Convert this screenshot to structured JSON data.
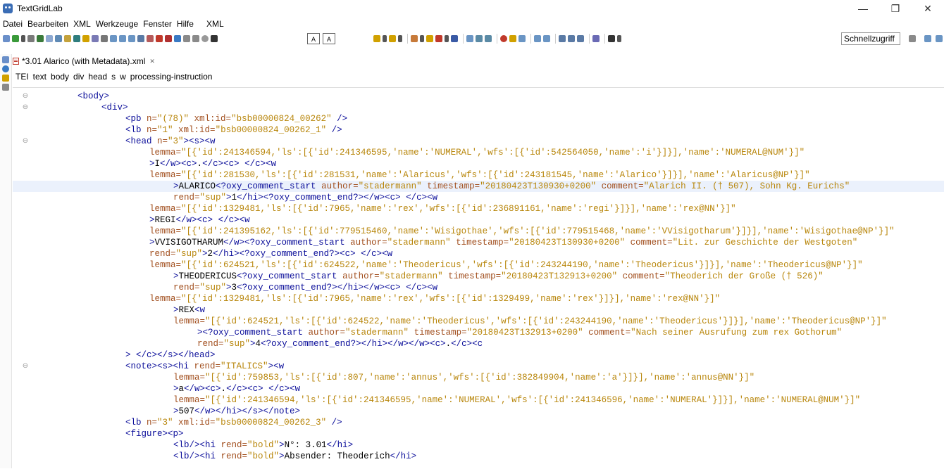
{
  "window": {
    "title": "TextGridLab",
    "minimize": "—",
    "maximize": "❐",
    "close": "✕"
  },
  "menu": [
    "Datei",
    "Bearbeiten",
    "XML",
    "Werkzeuge",
    "Fenster",
    "Hilfe",
    "XML"
  ],
  "toolbar": {
    "quick_access": "Schnellzugriff",
    "text_btn_1": "A",
    "text_btn_2": "A"
  },
  "editor": {
    "tab_title": "*3.01 Alarico (with Metadata).xml",
    "tab_close": "✕",
    "current_line_index": 8
  },
  "breadcrumbs": [
    "TEI",
    "text",
    "body",
    "div",
    "head",
    "s",
    "w",
    "processing-instruction"
  ],
  "colors": {
    "tag": "#0b0e9a",
    "attr_name": "#a14e1d",
    "attr_value": "#b8860b",
    "current_line": "#ebf1fc"
  },
  "code_lines": [
    {
      "indent": 0,
      "fold": true,
      "segs": [
        [
          "t",
          "<body>"
        ]
      ]
    },
    {
      "indent": 1,
      "fold": true,
      "segs": [
        [
          "t",
          "<div>"
        ]
      ]
    },
    {
      "indent": 2,
      "fold": false,
      "segs": [
        [
          "t",
          "<pb "
        ],
        [
          "a",
          "n="
        ],
        [
          "v",
          "\"(78)\""
        ],
        [
          "a",
          " xml:id="
        ],
        [
          "v",
          "\"bsb00000824_00262\""
        ],
        [
          "t",
          " />"
        ]
      ]
    },
    {
      "indent": 2,
      "fold": false,
      "segs": [
        [
          "t",
          "<lb "
        ],
        [
          "a",
          "n="
        ],
        [
          "v",
          "\"1\""
        ],
        [
          "a",
          " xml:id="
        ],
        [
          "v",
          "\"bsb00000824_00262_1\""
        ],
        [
          "t",
          " />"
        ]
      ]
    },
    {
      "indent": 2,
      "fold": true,
      "segs": [
        [
          "t",
          "<head "
        ],
        [
          "a",
          "n="
        ],
        [
          "v",
          "\"3\""
        ],
        [
          "t",
          "><s><w"
        ]
      ]
    },
    {
      "indent": 3,
      "fold": false,
      "segs": [
        [
          "a",
          "lemma="
        ],
        [
          "v",
          "\"[{'id':241346594,'ls':[{'id':241346595,'name':'NUMERAL','wfs':[{'id':542564050,'name':'i'}]}],'name':'NUMERAL@NUM'}]\""
        ]
      ]
    },
    {
      "indent": 3,
      "fold": false,
      "segs": [
        [
          "t",
          ">"
        ],
        [
          "x",
          "I"
        ],
        [
          "t",
          "</w><c>"
        ],
        [
          "x",
          "."
        ],
        [
          "t",
          "</c><c>"
        ],
        [
          "x",
          " "
        ],
        [
          "t",
          "</c><w"
        ]
      ]
    },
    {
      "indent": 3,
      "fold": false,
      "segs": [
        [
          "a",
          "lemma="
        ],
        [
          "v",
          "\"[{'id':281530,'ls':[{'id':281531,'name':'Alaricus','wfs':[{'id':243181545,'name':'Alarico'}]}],'name':'Alaricus@NP'}]\""
        ]
      ]
    },
    {
      "indent": 4,
      "fold": false,
      "segs": [
        [
          "t",
          ">"
        ],
        [
          "x",
          "ALARICO"
        ],
        [
          "t",
          "<?oxy_comment_start "
        ],
        [
          "a",
          "author="
        ],
        [
          "v",
          "\"stadermann\""
        ],
        [
          "a",
          " timestamp="
        ],
        [
          "v",
          "\"20180423T130930+0200\""
        ],
        [
          "a",
          " comment="
        ],
        [
          "v",
          "\"Alarich II. († 507), Sohn Kg. Eurichs\""
        ]
      ]
    },
    {
      "indent": 4,
      "fold": false,
      "segs": [
        [
          "a",
          "rend="
        ],
        [
          "v",
          "\"sup\""
        ],
        [
          "t",
          ">"
        ],
        [
          "x",
          "1"
        ],
        [
          "t",
          "</hi><?oxy_comment_end?></w><c>"
        ],
        [
          "x",
          " "
        ],
        [
          "t",
          "</c><w"
        ]
      ]
    },
    {
      "indent": 3,
      "fold": false,
      "segs": [
        [
          "a",
          "lemma="
        ],
        [
          "v",
          "\"[{'id':1329481,'ls':[{'id':7965,'name':'rex','wfs':[{'id':236891161,'name':'regi'}]}],'name':'rex@NN'}]\""
        ]
      ]
    },
    {
      "indent": 3,
      "fold": false,
      "segs": [
        [
          "t",
          ">"
        ],
        [
          "x",
          "REGI"
        ],
        [
          "t",
          "</w><c>"
        ],
        [
          "x",
          " "
        ],
        [
          "t",
          "</c><w"
        ]
      ]
    },
    {
      "indent": 3,
      "fold": false,
      "segs": [
        [
          "a",
          "lemma="
        ],
        [
          "v",
          "\"[{'id':241395162,'ls':[{'id':779515460,'name':'Wisigothae','wfs':[{'id':779515468,'name':'VVisigotharum'}]}],'name':'Wisigothae@NP'}]\""
        ]
      ]
    },
    {
      "indent": 3,
      "fold": false,
      "segs": [
        [
          "t",
          ">"
        ],
        [
          "x",
          "VVISIGOTHARUM"
        ],
        [
          "t",
          "</w><?oxy_comment_start "
        ],
        [
          "a",
          "author="
        ],
        [
          "v",
          "\"stadermann\""
        ],
        [
          "a",
          " timestamp="
        ],
        [
          "v",
          "\"20180423T130930+0200\""
        ],
        [
          "a",
          " comment="
        ],
        [
          "v",
          "\"Lit. zur Geschichte der Westgoten\""
        ]
      ]
    },
    {
      "indent": 3,
      "fold": false,
      "segs": [
        [
          "a",
          "rend="
        ],
        [
          "v",
          "\"sup\""
        ],
        [
          "t",
          ">"
        ],
        [
          "x",
          "2"
        ],
        [
          "t",
          "</hi><?oxy_comment_end?><c>"
        ],
        [
          "x",
          " "
        ],
        [
          "t",
          "</c><w"
        ]
      ]
    },
    {
      "indent": 3,
      "fold": false,
      "segs": [
        [
          "a",
          "lemma="
        ],
        [
          "v",
          "\"[{'id':624521,'ls':[{'id':624522,'name':'Theodericus','wfs':[{'id':243244190,'name':'Theodericus'}]}],'name':'Theodericus@NP'}]\""
        ]
      ]
    },
    {
      "indent": 4,
      "fold": false,
      "segs": [
        [
          "t",
          ">"
        ],
        [
          "x",
          "THEODERICUS"
        ],
        [
          "t",
          "<?oxy_comment_start "
        ],
        [
          "a",
          "author="
        ],
        [
          "v",
          "\"stadermann\""
        ],
        [
          "a",
          " timestamp="
        ],
        [
          "v",
          "\"20180423T132913+0200\""
        ],
        [
          "a",
          " comment="
        ],
        [
          "v",
          "\"Theoderich der Große († 526)\""
        ]
      ]
    },
    {
      "indent": 4,
      "fold": false,
      "segs": [
        [
          "a",
          "rend="
        ],
        [
          "v",
          "\"sup\""
        ],
        [
          "t",
          ">"
        ],
        [
          "x",
          "3"
        ],
        [
          "t",
          "<?oxy_comment_end?></hi></w><c>"
        ],
        [
          "x",
          " "
        ],
        [
          "t",
          "</c><w"
        ]
      ]
    },
    {
      "indent": 3,
      "fold": false,
      "segs": [
        [
          "a",
          "lemma="
        ],
        [
          "v",
          "\"[{'id':1329481,'ls':[{'id':7965,'name':'rex','wfs':[{'id':1329499,'name':'rex'}]}],'name':'rex@NN'}]\""
        ]
      ]
    },
    {
      "indent": 4,
      "fold": false,
      "segs": [
        [
          "t",
          ">"
        ],
        [
          "x",
          "REX"
        ],
        [
          "t",
          "<w"
        ]
      ]
    },
    {
      "indent": 4,
      "fold": false,
      "segs": [
        [
          "a",
          "lemma="
        ],
        [
          "v",
          "\"[{'id':624521,'ls':[{'id':624522,'name':'Theodericus','wfs':[{'id':243244190,'name':'Theodericus'}]}],'name':'Theodericus@NP'}]\""
        ]
      ]
    },
    {
      "indent": 5,
      "fold": false,
      "segs": [
        [
          "t",
          "><?oxy_comment_start "
        ],
        [
          "a",
          "author="
        ],
        [
          "v",
          "\"stadermann\""
        ],
        [
          "a",
          " timestamp="
        ],
        [
          "v",
          "\"20180423T132913+0200\""
        ],
        [
          "a",
          " comment="
        ],
        [
          "v",
          "\"Nach seiner Ausrufung zum rex Gothorum\""
        ]
      ]
    },
    {
      "indent": 5,
      "fold": false,
      "segs": [
        [
          "a",
          "rend="
        ],
        [
          "v",
          "\"sup\""
        ],
        [
          "t",
          ">"
        ],
        [
          "x",
          "4"
        ],
        [
          "t",
          "<?oxy_comment_end?></hi></w></w><c>"
        ],
        [
          "x",
          "."
        ],
        [
          "t",
          "</c><c"
        ]
      ]
    },
    {
      "indent": 2,
      "fold": false,
      "segs": [
        [
          "t",
          "> </c></s></head>"
        ]
      ]
    },
    {
      "indent": 2,
      "fold": true,
      "segs": [
        [
          "t",
          "<note><s><hi "
        ],
        [
          "a",
          "rend="
        ],
        [
          "v",
          "\"ITALICS\""
        ],
        [
          "t",
          "><w"
        ]
      ]
    },
    {
      "indent": 4,
      "fold": false,
      "segs": [
        [
          "a",
          "lemma="
        ],
        [
          "v",
          "\"[{'id':759853,'ls':[{'id':807,'name':'annus','wfs':[{'id':382849904,'name':'a'}]}],'name':'annus@NN'}]\""
        ]
      ]
    },
    {
      "indent": 4,
      "fold": false,
      "segs": [
        [
          "t",
          ">"
        ],
        [
          "x",
          "a"
        ],
        [
          "t",
          "</w><c>"
        ],
        [
          "x",
          "."
        ],
        [
          "t",
          "</c><c>"
        ],
        [
          "x",
          " "
        ],
        [
          "t",
          "</c><w"
        ]
      ]
    },
    {
      "indent": 4,
      "fold": false,
      "segs": [
        [
          "a",
          "lemma="
        ],
        [
          "v",
          "\"[{'id':241346594,'ls':[{'id':241346595,'name':'NUMERAL','wfs':[{'id':241346596,'name':'NUMERAL'}]}],'name':'NUMERAL@NUM'}]\""
        ]
      ]
    },
    {
      "indent": 4,
      "fold": false,
      "segs": [
        [
          "t",
          ">"
        ],
        [
          "x",
          "507"
        ],
        [
          "t",
          "</w></hi></s></note>"
        ]
      ]
    },
    {
      "indent": 2,
      "fold": false,
      "segs": [
        [
          "t",
          "<lb "
        ],
        [
          "a",
          "n="
        ],
        [
          "v",
          "\"3\""
        ],
        [
          "a",
          " xml:id="
        ],
        [
          "v",
          "\"bsb00000824_00262_3\""
        ],
        [
          "t",
          " />"
        ]
      ]
    },
    {
      "indent": 2,
      "fold": false,
      "segs": [
        [
          "t",
          "<figure><p>"
        ]
      ]
    },
    {
      "indent": 4,
      "fold": false,
      "segs": [
        [
          "t",
          "<lb/><hi "
        ],
        [
          "a",
          "rend="
        ],
        [
          "v",
          "\"bold\""
        ],
        [
          "t",
          ">"
        ],
        [
          "x",
          "N°: 3.01"
        ],
        [
          "t",
          "</hi>"
        ]
      ]
    },
    {
      "indent": 4,
      "fold": false,
      "segs": [
        [
          "t",
          "<lb/><hi "
        ],
        [
          "a",
          "rend="
        ],
        [
          "v",
          "\"bold\""
        ],
        [
          "t",
          ">"
        ],
        [
          "x",
          "Absender: Theoderich"
        ],
        [
          "t",
          "</hi>"
        ]
      ]
    }
  ]
}
